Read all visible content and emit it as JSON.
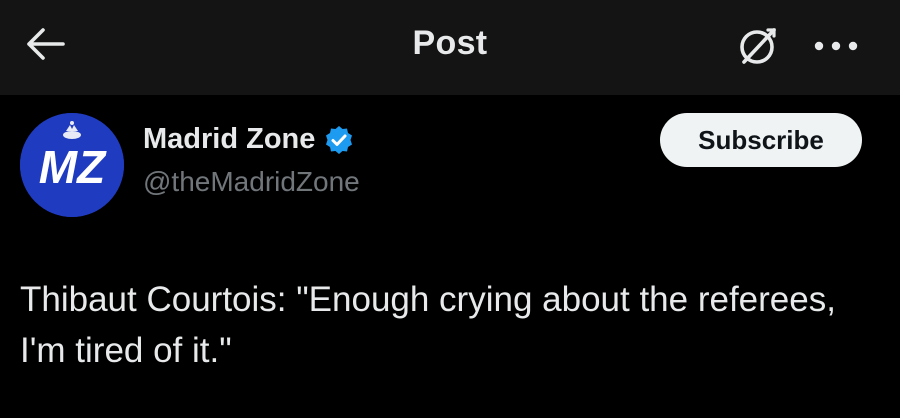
{
  "header": {
    "title": "Post",
    "back_icon": "arrow-left-icon",
    "grok_icon": "grok-icon",
    "more_icon": "more-horizontal-icon"
  },
  "author": {
    "avatar_text": "MZ",
    "display_name": "Madrid Zone",
    "handle": "@theMadridZone",
    "verified": true,
    "verified_color": "#1d9bf0",
    "avatar_color": "#1f3bbf"
  },
  "actions": {
    "subscribe_label": "Subscribe"
  },
  "post": {
    "text": "Thibaut Courtois: \"Enough crying about the referees, I'm tired of it.\""
  }
}
